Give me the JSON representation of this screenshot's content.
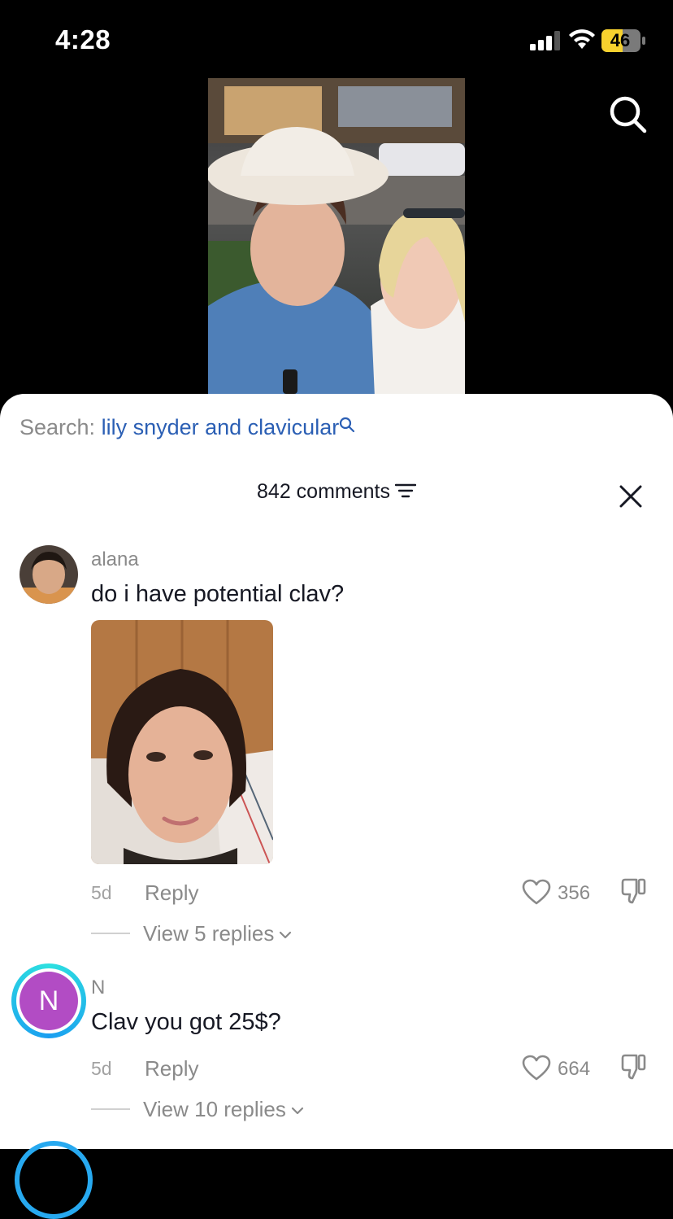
{
  "status_bar": {
    "time": "4:28",
    "battery": "46"
  },
  "search": {
    "label": "Search:",
    "query": "lily snyder and clavicular"
  },
  "comments_header": {
    "count_label": "842 comments"
  },
  "comments": [
    {
      "username": "alana",
      "text": "do i have potential clav?",
      "age": "5d",
      "reply_label": "Reply",
      "likes": "356",
      "view_replies": "View 5 replies"
    },
    {
      "username": "N",
      "avatar_letter": "N",
      "text": "Clav you got 25$?",
      "age": "5d",
      "reply_label": "Reply",
      "likes": "664",
      "view_replies": "View 10 replies"
    }
  ],
  "colors": {
    "accent_link": "#2b5fb4",
    "avatar_n": "#b24cc4",
    "battery": "#f7d12e"
  },
  "icons": [
    "search-icon",
    "sort-icon",
    "close-icon",
    "heart-icon",
    "dislike-icon",
    "chevron-down-icon",
    "signal-icon",
    "wifi-icon",
    "battery-icon"
  ]
}
